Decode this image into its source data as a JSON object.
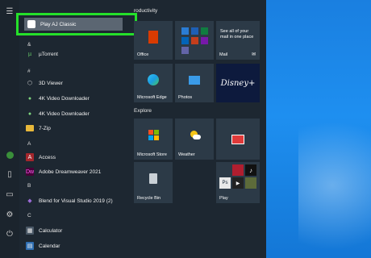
{
  "desktop": {},
  "highlighted_app": "Play AJ Classic",
  "app_list": {
    "items": [
      {
        "label": "µTorrent",
        "icon": "utorrent-icon"
      },
      {
        "label": "3D Viewer",
        "icon": "cube-icon"
      },
      {
        "label": "4K Video Downloader",
        "icon": "download-icon"
      },
      {
        "label": "4K Video Downloader",
        "icon": "download-icon"
      },
      {
        "label": "7-Zip",
        "icon": "folder-icon"
      },
      {
        "label": "Access",
        "icon": "access-icon"
      },
      {
        "label": "Adobe Dreamweaver 2021",
        "icon": "dreamweaver-icon"
      },
      {
        "label": "Blend for Visual Studio 2019 (2)",
        "icon": "blend-icon"
      },
      {
        "label": "Calculator",
        "icon": "calculator-icon"
      },
      {
        "label": "Calendar",
        "icon": "calendar-icon"
      }
    ],
    "letters": [
      "&",
      "#",
      "A",
      "B",
      "C"
    ]
  },
  "tiles": {
    "section1_title": "roductivity",
    "section2_title": "Explore",
    "office_label": "Office",
    "mail_text": "See all of your mail in one place",
    "mail_label": "Mail",
    "edge_label": "Microsoft Edge",
    "photos_label": "Photos",
    "disney_label": "Disney+",
    "store_label": "Microsoft Store",
    "weather_label": "Weather",
    "recycle_label": "Recycle Bin",
    "play_label": "Play"
  }
}
